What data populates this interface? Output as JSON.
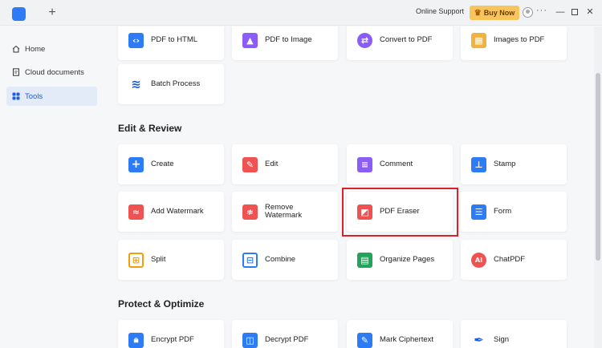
{
  "titlebar": {
    "new_tab": "+",
    "online_support": "Online Support",
    "buy_now": "Buy Now",
    "more": "···",
    "minimize": "—",
    "close": "✕"
  },
  "sidebar": {
    "items": [
      {
        "label": "Home",
        "icon": "home-icon"
      },
      {
        "label": "Cloud documents",
        "icon": "cloud-documents-icon"
      },
      {
        "label": "Tools",
        "icon": "tools-icon",
        "active": true
      }
    ]
  },
  "top_row": [
    {
      "label": "PDF to HTML",
      "icon": "code-icon",
      "color": "#2d7cf6"
    },
    {
      "label": "PDF to Image",
      "icon": "image-icon",
      "color": "#8b5cf6"
    },
    {
      "label": "Convert to PDF",
      "icon": "convert-icon",
      "color": "#8b5cf6"
    },
    {
      "label": "Images to PDF",
      "icon": "images-icon",
      "color": "#f2b33d"
    },
    {
      "label": "Batch Process",
      "icon": "layers-icon",
      "color": "#1e5ed8"
    }
  ],
  "edit_review": {
    "title": "Edit & Review",
    "tools": [
      {
        "label": "Create",
        "icon": "plus-icon",
        "color": "#2d7cf6"
      },
      {
        "label": "Edit",
        "icon": "edit-icon",
        "color": "#f05252"
      },
      {
        "label": "Comment",
        "icon": "comment-icon",
        "color": "#8b5cf6"
      },
      {
        "label": "Stamp",
        "icon": "stamp-icon",
        "color": "#2d7cf6"
      },
      {
        "label": "Add Watermark",
        "icon": "watermark-icon",
        "color": "#f05252"
      },
      {
        "label": "Remove Watermark",
        "label_line1": "Remove",
        "label_line2": "Watermark",
        "icon": "remove-watermark-icon",
        "color": "#f05252"
      },
      {
        "label": "PDF Eraser",
        "icon": "eraser-icon",
        "color": "#f05252"
      },
      {
        "label": "Form",
        "icon": "form-icon",
        "color": "#2d7cf6"
      },
      {
        "label": "Split",
        "icon": "split-icon",
        "color": "#f59e0b"
      },
      {
        "label": "Combine",
        "icon": "combine-icon",
        "color": "#2d7cf6"
      },
      {
        "label": "Organize Pages",
        "icon": "organize-icon",
        "color": "#22a55b"
      },
      {
        "label": "ChatPDF",
        "icon": "ai-icon",
        "color": "#f05252"
      }
    ]
  },
  "protect": {
    "title": "Protect & Optimize",
    "tools": [
      {
        "label": "Encrypt PDF",
        "icon": "lock-icon",
        "color": "#2d7cf6"
      },
      {
        "label": "Decrypt PDF",
        "icon": "unlock-icon",
        "color": "#2d7cf6"
      },
      {
        "label": "Mark Ciphertext",
        "icon": "cipher-icon",
        "color": "#2d7cf6"
      },
      {
        "label": "Sign",
        "icon": "pen-icon",
        "color": "#1e5ed8"
      }
    ]
  },
  "colors": {
    "accent": "#2d7cf6",
    "highlight": "#d8232a",
    "buy_now": "#f7c45d"
  }
}
